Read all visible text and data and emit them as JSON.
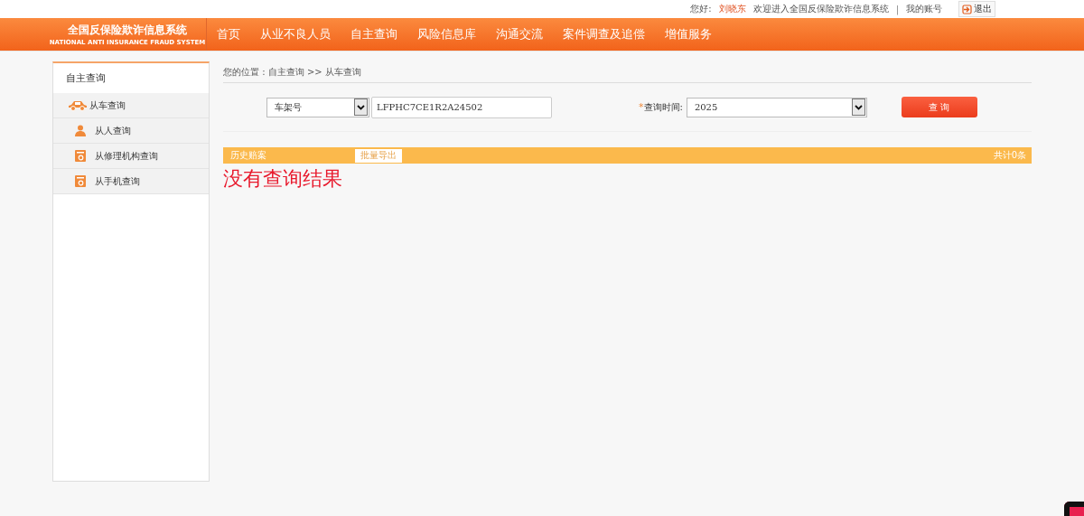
{
  "top_bar": {
    "greeting": "您好:",
    "user_name": "刘晓东",
    "welcome": "欢迎进入全国反保险欺诈信息系统",
    "separator": "|",
    "account_link": "我的账号",
    "logout_button": "退出"
  },
  "header": {
    "logo_title": "全国反保险欺诈信息系统",
    "logo_subtitle": "NATIONAL ANTI INSURANCE FRAUD SYSTEM",
    "nav_items": [
      "首页",
      "从业不良人员",
      "自主查询",
      "风险信息库",
      "沟通交流",
      "案件调查及追偿",
      "增值服务"
    ]
  },
  "sidebar": {
    "title": "自主查询",
    "items": [
      {
        "label": "从车查询",
        "kind": "car"
      },
      {
        "label": "从人查询",
        "kind": "person"
      },
      {
        "label": "从修理机构查询",
        "kind": "org"
      },
      {
        "label": "从手机查询",
        "kind": "org"
      }
    ]
  },
  "breadcrumb": "您的位置 : 自主查询 >> 从车查询",
  "search": {
    "type_select": "车架号",
    "vin_value": "LFPHC7CE1R2A24502",
    "time_required_mark": "*",
    "time_label": "查询时间:",
    "time_select": "2025",
    "query_button": "查 询"
  },
  "results_bar": {
    "title": "历史赔案",
    "export_button": "批量导出",
    "total": "共计0条"
  },
  "empty_message": "没有查询结果"
}
